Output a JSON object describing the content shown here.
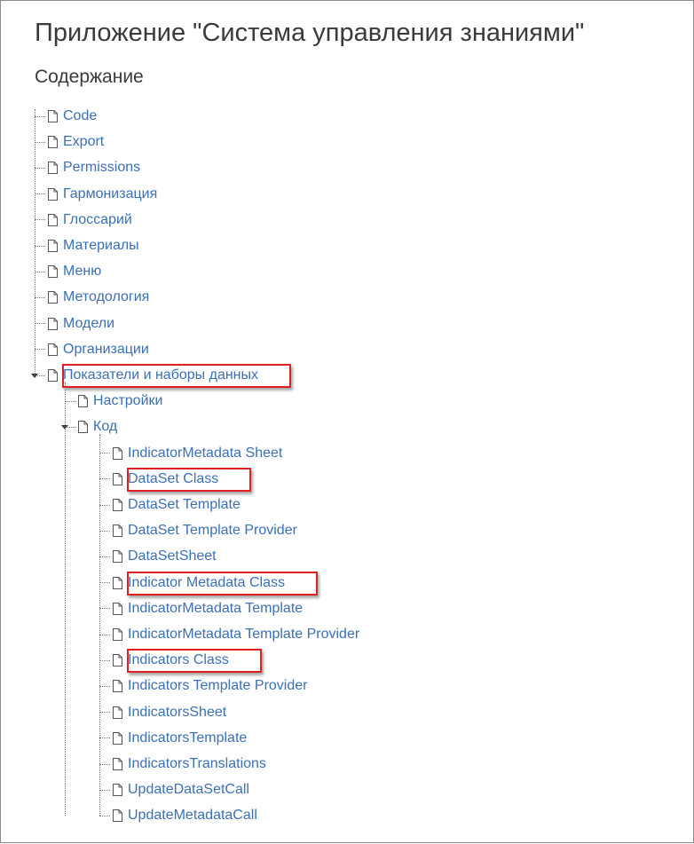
{
  "page": {
    "title": "Приложение \"Система управления знаниями\"",
    "subtitle": "Содержание"
  },
  "tree": [
    {
      "label": "Code",
      "expanded": false,
      "highlighted": false
    },
    {
      "label": "Export",
      "expanded": false,
      "highlighted": false
    },
    {
      "label": "Permissions",
      "expanded": false,
      "highlighted": false
    },
    {
      "label": "Гармонизация",
      "expanded": false,
      "highlighted": false
    },
    {
      "label": "Глоссарий",
      "expanded": false,
      "highlighted": false
    },
    {
      "label": "Материалы",
      "expanded": false,
      "highlighted": false
    },
    {
      "label": "Меню",
      "expanded": false,
      "highlighted": false
    },
    {
      "label": "Методология",
      "expanded": false,
      "highlighted": false
    },
    {
      "label": "Модели",
      "expanded": false,
      "highlighted": false
    },
    {
      "label": "Организации",
      "expanded": false,
      "highlighted": false
    },
    {
      "label": "Показатели и наборы данных",
      "expanded": true,
      "highlighted": true,
      "children": [
        {
          "label": "Настройки",
          "expanded": false,
          "highlighted": false
        },
        {
          "label": "Код",
          "expanded": true,
          "highlighted": false,
          "children": [
            {
              "label": "IndicatorMetadata Sheet",
              "highlighted": false
            },
            {
              "label": "DataSet Class",
              "highlighted": true
            },
            {
              "label": "DataSet Template",
              "highlighted": false
            },
            {
              "label": "DataSet Template Provider",
              "highlighted": false
            },
            {
              "label": "DataSetSheet",
              "highlighted": false
            },
            {
              "label": "Indicator Metadata Class",
              "highlighted": true
            },
            {
              "label": "IndicatorMetadata Template",
              "highlighted": false
            },
            {
              "label": "IndicatorMetadata Template Provider",
              "highlighted": false
            },
            {
              "label": "Indicators Class",
              "highlighted": true
            },
            {
              "label": "Indicators Template Provider",
              "highlighted": false
            },
            {
              "label": "IndicatorsSheet",
              "highlighted": false
            },
            {
              "label": "IndicatorsTemplate",
              "highlighted": false
            },
            {
              "label": "IndicatorsTranslations",
              "highlighted": false
            },
            {
              "label": "UpdateDataSetCall",
              "highlighted": false
            },
            {
              "label": "UpdateMetadataCall",
              "highlighted": false
            }
          ]
        }
      ]
    }
  ],
  "colors": {
    "link": "#3b6fb6",
    "highlight_border": "#e02020",
    "text": "#3a3a3a"
  },
  "icons": {
    "node": "page-icon",
    "toggle": "expand-toggle-icon"
  }
}
